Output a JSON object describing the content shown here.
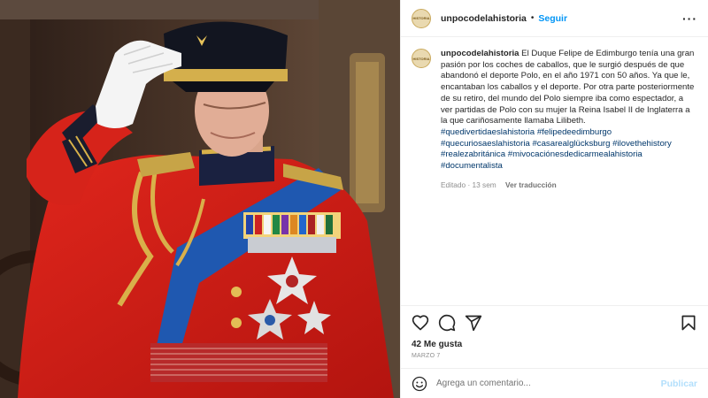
{
  "header": {
    "username": "unpocodelahistoria",
    "separator": "•",
    "follow_label": "Seguir",
    "more_icon": "more-options-icon"
  },
  "post": {
    "image_alt": "",
    "caption_username": "unpocodelahistoria",
    "caption_text": "El Duque Felipe de Edimburgo tenía una gran pasión por los coches de caballos, que le surgió después de que abandonó el deporte Polo, en el año 1971 con 50 años. Ya que le, encantaban los caballos y el deporte. Por otra parte posteriormente de su retiro, del mundo del Polo siempre iba como espectador, a ver partidas de Polo con su mujer la Reina Isabel II de Inglaterra a la que cariñosamente llamaba Lilibeth.",
    "hashtags": [
      "#quedivertidaeslahistoria",
      "#felipedeedimburgo",
      "#quecuriosaeslahistoria",
      "#casarealglücksburg",
      "#ilovethehistory",
      "#realezabritánica",
      "#mivocaciónesdedicarmealahistoria",
      "#documentalista"
    ],
    "meta_edited": "Editado · 13 sem",
    "translate_label": "Ver traducción"
  },
  "actions": {
    "icons": [
      "heart-icon",
      "comment-icon",
      "share-icon",
      "bookmark-icon"
    ],
    "likes": "42 Me gusta",
    "date": "MARZO 7"
  },
  "comment": {
    "placeholder": "Agrega un comentario...",
    "publish_label": "Publicar",
    "emoji_icon": "emoji-icon"
  },
  "colors": {
    "link_blue": "#0095f6",
    "hashtag_blue": "#00376b",
    "publish_disabled": "#b2dffc",
    "muted_text": "#8e8e8e"
  }
}
